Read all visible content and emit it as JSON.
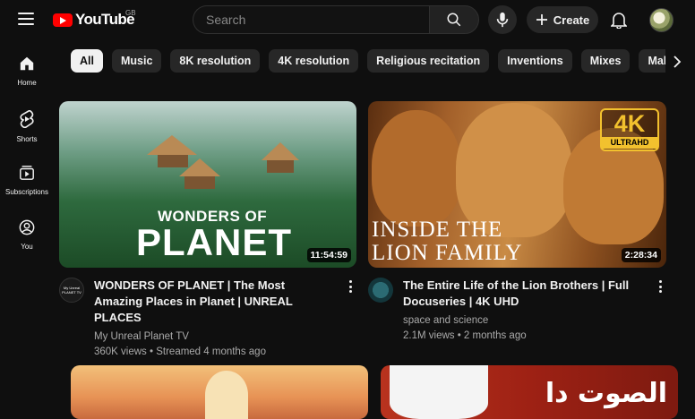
{
  "header": {
    "logo_text": "YouTube",
    "region": "GB",
    "search_placeholder": "Search",
    "create_label": "Create",
    "icons": [
      "menu-icon",
      "search-icon",
      "mic-icon",
      "plus-icon",
      "bell-icon"
    ]
  },
  "sidebar": {
    "items": [
      {
        "label": "Home",
        "icon": "home-icon"
      },
      {
        "label": "Shorts",
        "icon": "shorts-icon"
      },
      {
        "label": "Subscriptions",
        "icon": "subscriptions-icon"
      },
      {
        "label": "You",
        "icon": "you-icon"
      }
    ]
  },
  "chips": [
    "All",
    "Music",
    "8K resolution",
    "4K resolution",
    "Religious recitation",
    "Inventions",
    "Mixes",
    "Maher Zain"
  ],
  "videos": [
    {
      "thumb_line1": "WONDERS OF",
      "thumb_line2": "PLANET",
      "duration": "11:54:59",
      "title": "WONDERS OF PLANET | The Most Amazing Places in Planet | UNREAL PLACES",
      "channel": "My Unreal Planet TV",
      "channel_avatar_text": "My Unreal PLANET TV",
      "stats": "360K views • Streamed 4 months ago"
    },
    {
      "thumb_line1": "INSIDE THE",
      "thumb_line2": "LION FAMILY",
      "badge_big": "4K",
      "badge_small": "ULTRAHD",
      "duration": "2:28:34",
      "title": "The Entire Life of the Lion Brothers | Full Docuseries | 4K UHD",
      "channel": "space and science",
      "stats": "2.1M views • 2 months ago"
    },
    {},
    {
      "thumb_text": "الصوت دا"
    }
  ],
  "colors": {
    "background": "#0f0f0f",
    "brand_red": "#ff0000",
    "chip_bg": "#272727",
    "chip_active_bg": "#f1f1f1",
    "badge_gold": "#f2c12e"
  }
}
